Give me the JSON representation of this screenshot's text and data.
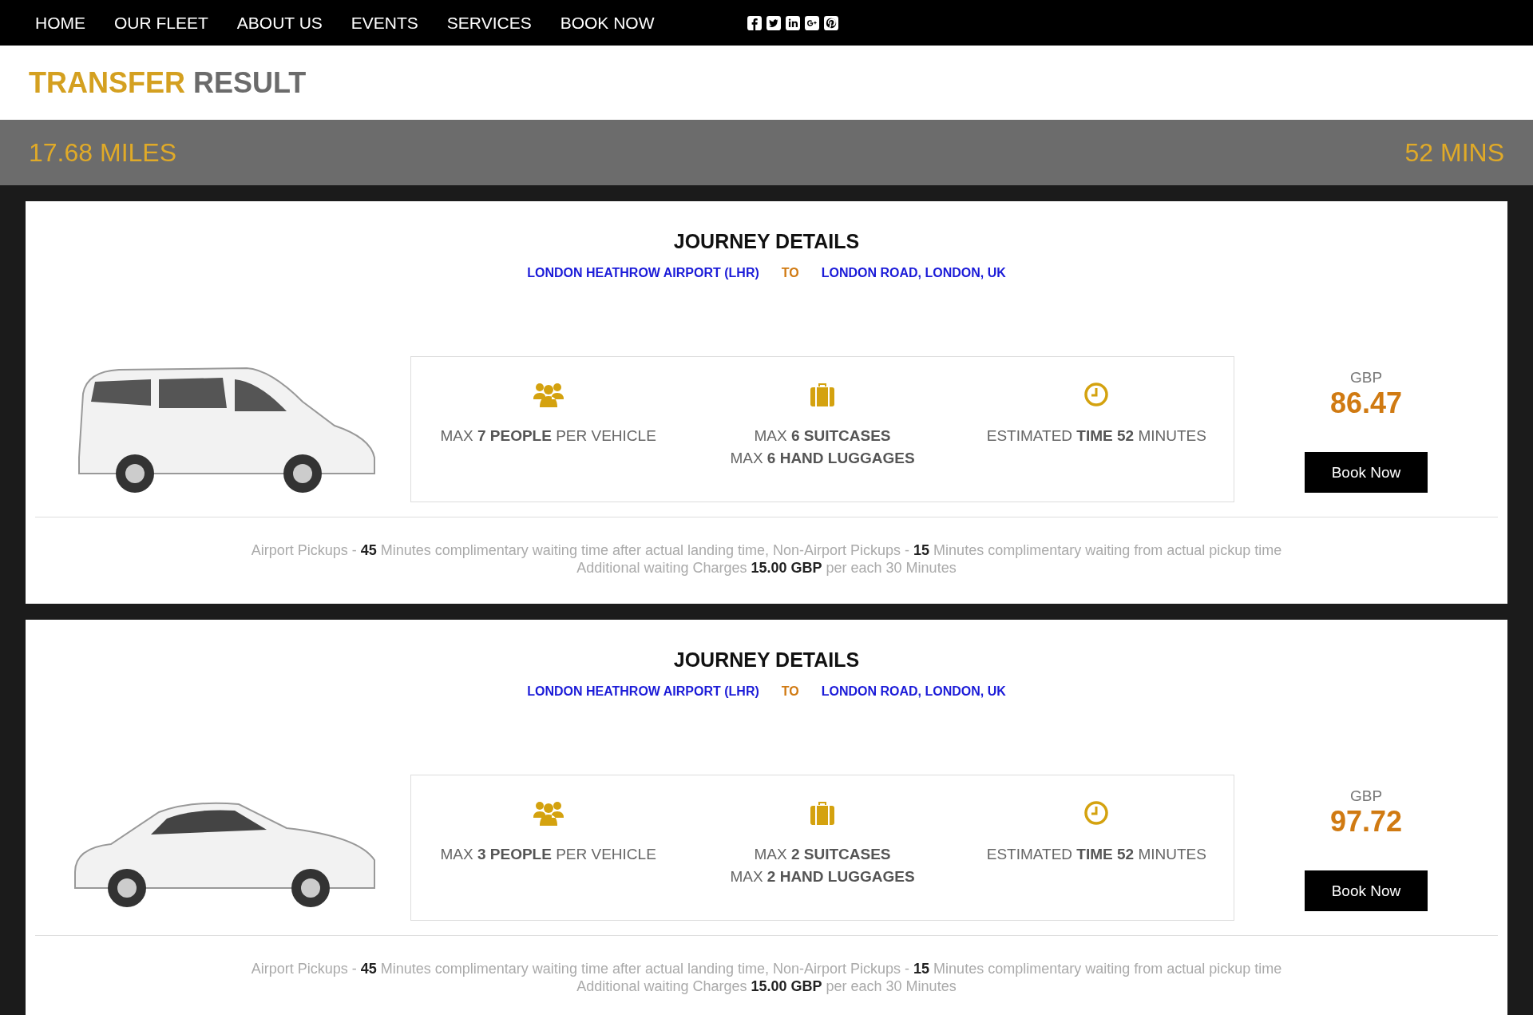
{
  "nav": {
    "items": [
      "HOME",
      "OUR FLEET",
      "ABOUT US",
      "EVENTS",
      "SERVICES",
      "BOOK NOW"
    ]
  },
  "page_title": {
    "highlight": "TRANSFER",
    "rest": "RESULT"
  },
  "summary": {
    "distance": "17.68 MILES",
    "duration": "52 MINS"
  },
  "results": [
    {
      "kind": "van",
      "title": "JOURNEY DETAILS",
      "from": "LONDON HEATHROW AIRPORT (LHR)",
      "to_label": "TO",
      "to": "LONDON ROAD, LONDON, UK",
      "features": [
        {
          "kind": "people",
          "lines": [
            "MAX **7 PEOPLE** PER VEHICLE"
          ]
        },
        {
          "kind": "luggage",
          "lines": [
            "MAX **6 SUITCASES**",
            "MAX **6 HAND LUGGAGES**"
          ]
        },
        {
          "kind": "time",
          "lines": [
            "ESTIMATED **TIME 52** MINUTES"
          ]
        }
      ],
      "currency": "GBP",
      "price": "86.47",
      "button": "Book Now",
      "notes": [
        "Airport Pickups - **45** Minutes complimentary waiting time after actual landing time, Non-Airport Pickups - **15** Minutes complimentary waiting from actual pickup time",
        "Additional waiting Charges **15.00 GBP** per each 30 Minutes"
      ]
    },
    {
      "kind": "car",
      "title": "JOURNEY DETAILS",
      "from": "LONDON HEATHROW AIRPORT (LHR)",
      "to_label": "TO",
      "to": "LONDON ROAD, LONDON, UK",
      "features": [
        {
          "kind": "people",
          "lines": [
            "MAX **3 PEOPLE** PER VEHICLE"
          ]
        },
        {
          "kind": "luggage",
          "lines": [
            "MAX **2 SUITCASES**",
            "MAX **2 HAND LUGGAGES**"
          ]
        },
        {
          "kind": "time",
          "lines": [
            "ESTIMATED **TIME 52** MINUTES"
          ]
        }
      ],
      "currency": "GBP",
      "price": "97.72",
      "button": "Book Now",
      "notes": [
        "Airport Pickups - **45** Minutes complimentary waiting time after actual landing time, Non-Airport Pickups - **15** Minutes complimentary waiting from actual pickup time",
        "Additional waiting Charges **15.00 GBP** per each 30 Minutes"
      ]
    }
  ]
}
